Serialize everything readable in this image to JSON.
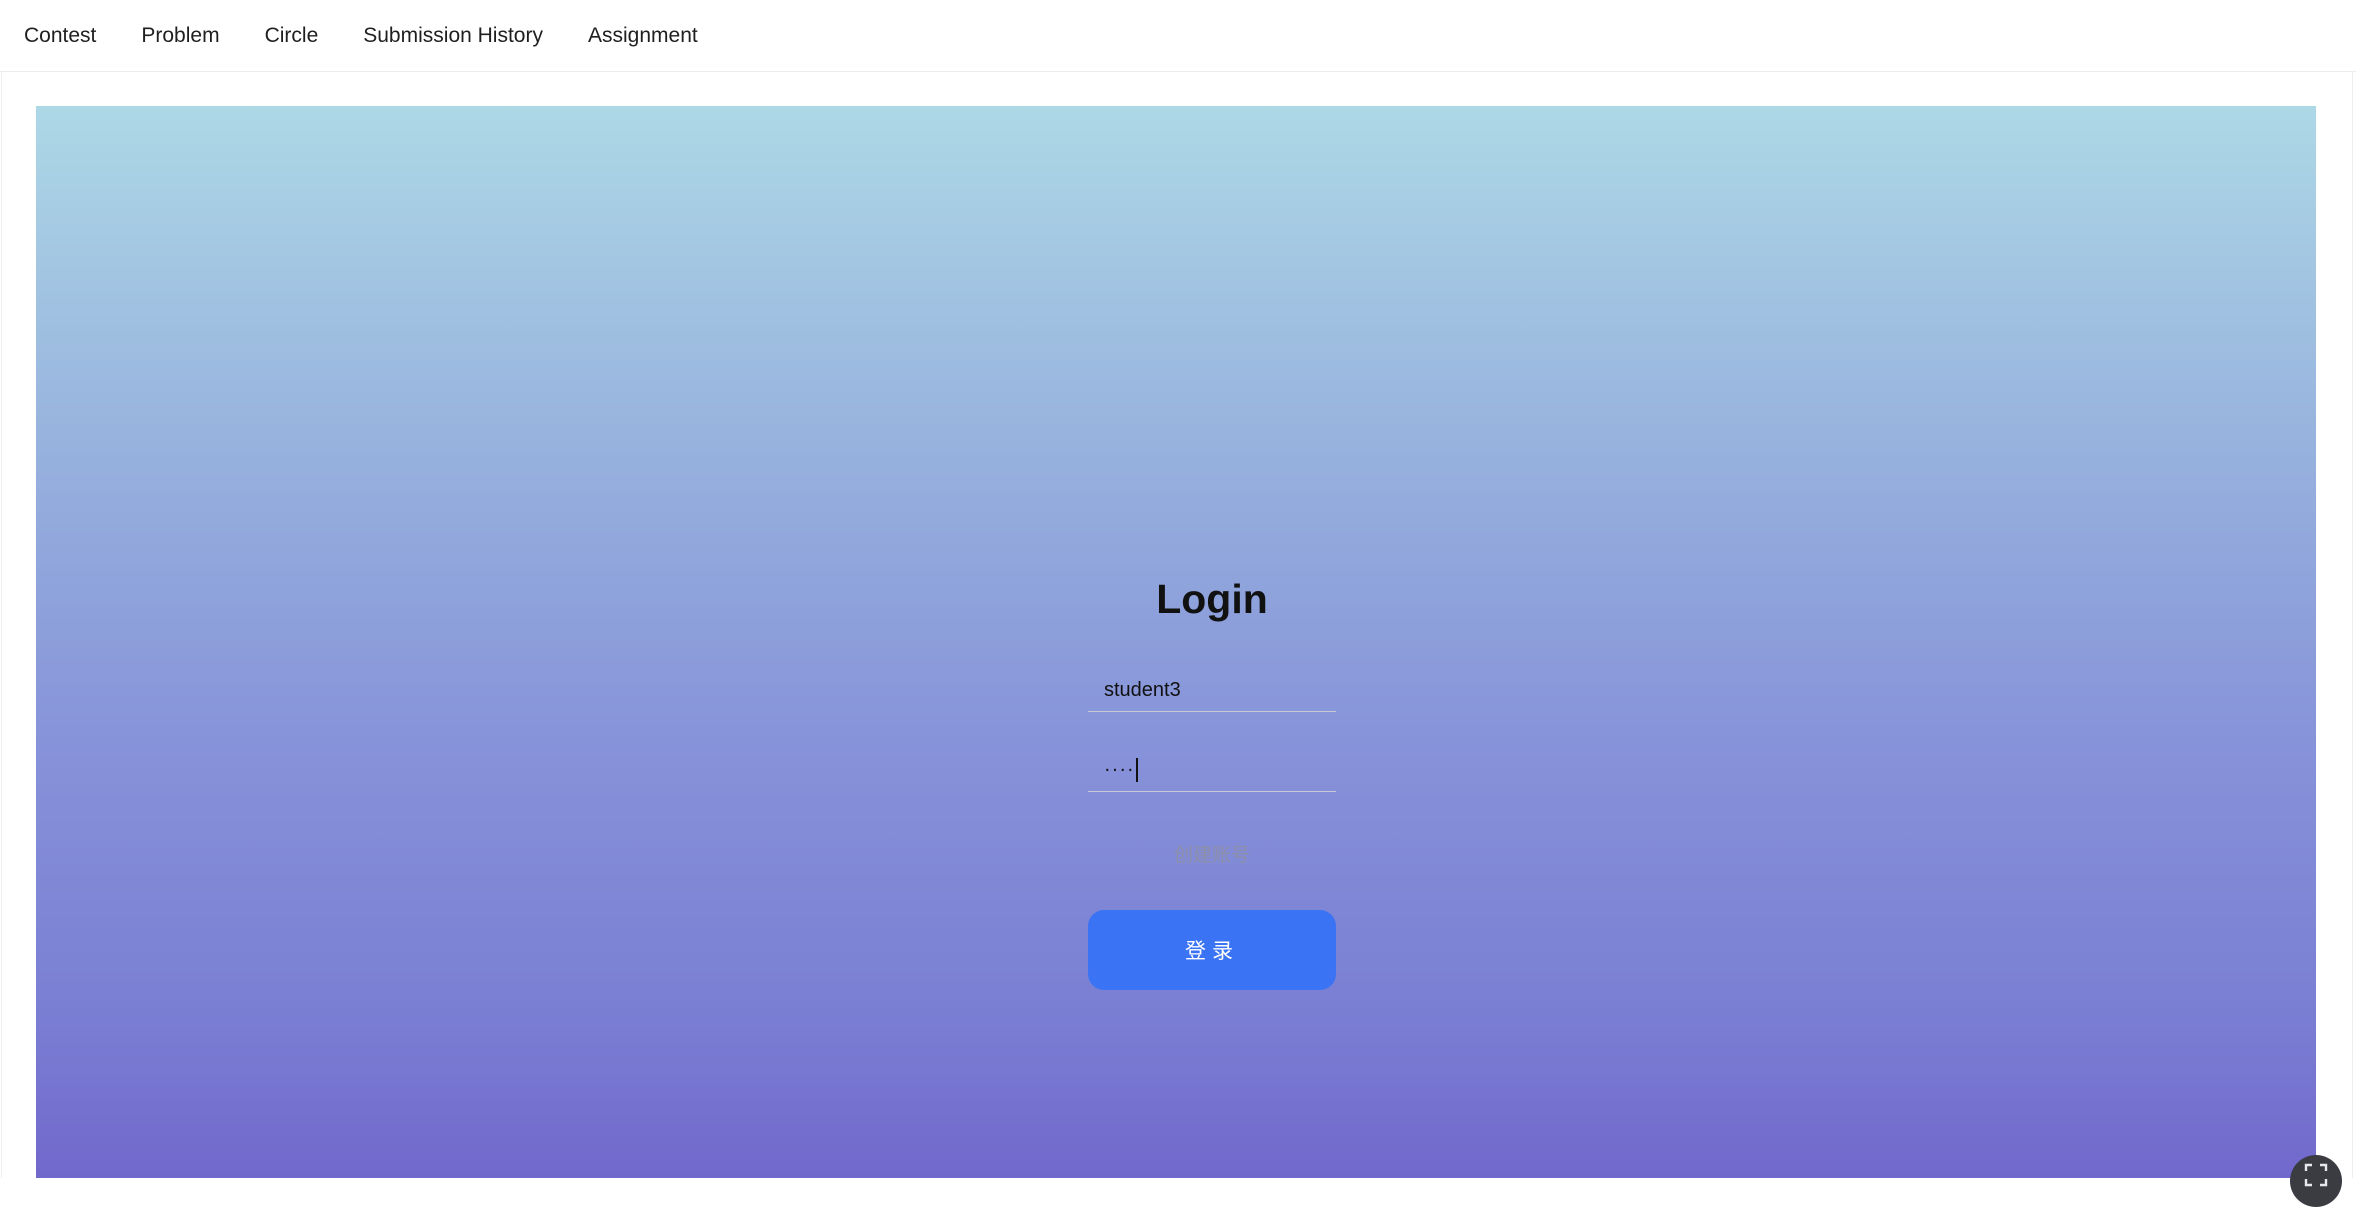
{
  "nav": {
    "items": [
      {
        "label": "Contest"
      },
      {
        "label": "Problem"
      },
      {
        "label": "Circle"
      },
      {
        "label": "Submission History"
      },
      {
        "label": "Assignment"
      }
    ]
  },
  "login": {
    "title": "Login",
    "username_value": "student3",
    "password_masked": "····",
    "create_account_label": "创建账号",
    "submit_label": "登录"
  },
  "colors": {
    "gradient_top": "#add8e6",
    "gradient_bottom": "#7168cc",
    "button": "#3a73f3"
  },
  "icons": {
    "fullscreen": "fullscreen-icon"
  }
}
